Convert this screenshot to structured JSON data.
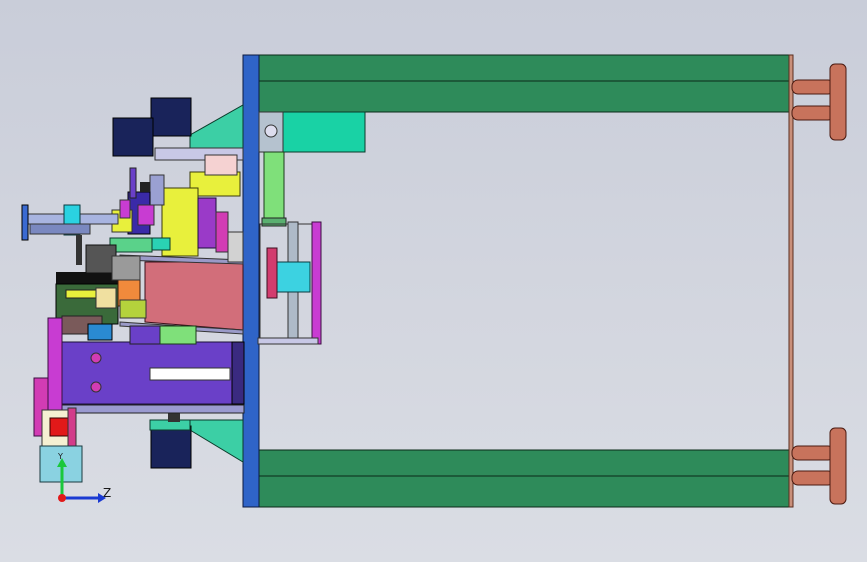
{
  "viewport": {
    "triad": {
      "z_label": "Z",
      "y_label": "Y"
    }
  },
  "colors": {
    "rail_green": "#2e8b5a",
    "plate_blue": "#2f64c8",
    "flange_copper": "#c8735c",
    "body_purple": "#6a40c8",
    "magenta": "#c83cd2",
    "yellow": "#e8f03c",
    "cyan": "#3cd2e1",
    "navy": "#19235a",
    "pink_block": "#d26e7a",
    "teal": "#19d2a5"
  }
}
